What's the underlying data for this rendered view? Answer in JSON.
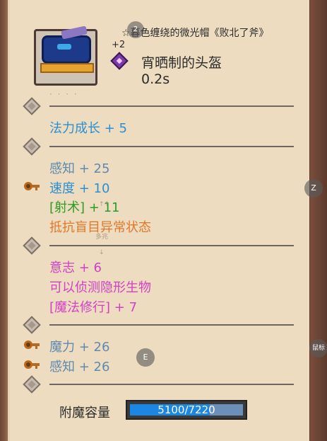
{
  "item": {
    "name": "☆暮色缠绕的微光帽《败北了斧》",
    "level": "+2",
    "type": "宵晒制的头盔",
    "time": "0.2s",
    "faded_line": "· · · ·"
  },
  "sections": [
    {
      "lines": [
        {
          "text": "法力成长 + 5",
          "color": "blue"
        }
      ]
    },
    {
      "lines": [
        {
          "text": "感知 + 25",
          "color": "grayblue"
        },
        {
          "text": "速度 + 10",
          "color": "blue"
        },
        {
          "text": "[射术] + 11",
          "color": "green"
        },
        {
          "text": "抵抗盲目异常状态",
          "color": "orange"
        }
      ]
    },
    {
      "lines": [
        {
          "text": "意志 + 6",
          "color": "pink"
        },
        {
          "text": "可以侦测隐形生物",
          "color": "pink"
        },
        {
          "text": "[魔法修行] + 7",
          "color": "pink"
        }
      ]
    },
    {
      "lines": [
        {
          "text": "魔力 + 26",
          "color": "grayblue"
        },
        {
          "text": "感知 + 26",
          "color": "grayblue"
        }
      ]
    }
  ],
  "notes": {
    "note_1": "↑↑",
    "note_2": "多兆",
    "note_3": "↓"
  },
  "overlays": {
    "badge_2": "2",
    "badge_z": "Z",
    "badge_e": "E",
    "badge_right": "鼠标"
  },
  "enchant": {
    "label": "附魔容量",
    "value_text": "5100/7220",
    "current": 5100,
    "max": 7220
  }
}
